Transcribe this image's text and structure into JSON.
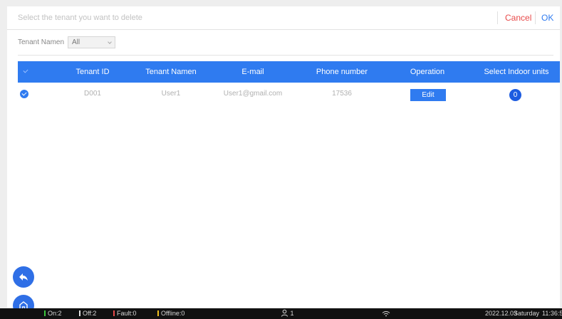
{
  "header": {
    "prompt": "Select the tenant you want to delete",
    "cancel_label": "Cancel",
    "ok_label": "OK"
  },
  "filter": {
    "label": "Tenant Namen",
    "selected": "All"
  },
  "table": {
    "columns": [
      "Tenant ID",
      "Tenant Namen",
      "E-mail",
      "Phone number",
      "Operation",
      "Select Indoor units"
    ],
    "rows": [
      {
        "selected": true,
        "tenant_id": "D001",
        "tenant_name": "User1",
        "email": "User1@gmail.com",
        "phone": "17536",
        "operation": "Edit",
        "indoor_units": "0"
      }
    ]
  },
  "statusbar": {
    "on": "On:2",
    "off": "Off:2",
    "fault": "Fault:0",
    "offline": "Offline:0",
    "users": "1",
    "date": "2022.12.03",
    "weekday": "Saturday",
    "time": "11:36:5"
  },
  "colors": {
    "accent": "#2f7bf0",
    "cancel": "#e84a4a",
    "on": "#3cc83c",
    "off": "#e0e0e0",
    "fault": "#e84a4a",
    "offline": "#f0c020"
  },
  "icons": {
    "back": "back-arrow-icon",
    "home": "home-icon",
    "user": "user-icon",
    "wifi": "wifi-icon",
    "check": "check-icon"
  }
}
